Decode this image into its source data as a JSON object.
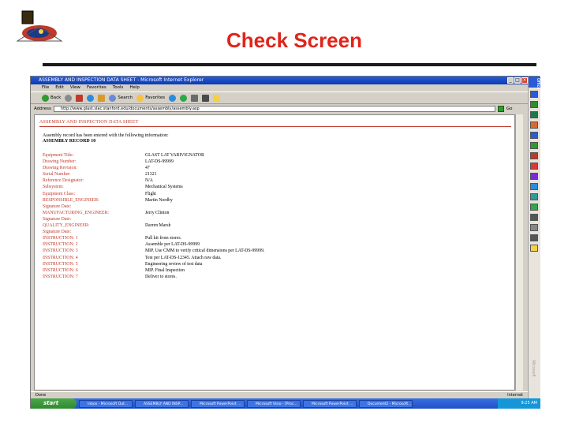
{
  "slide": {
    "title": "Check Screen"
  },
  "window": {
    "title": "ASSEMBLY AND INSPECTION DATA SHEET - Microsoft Internet Explorer",
    "menu": [
      "File",
      "Edit",
      "View",
      "Favorites",
      "Tools",
      "Help"
    ],
    "toolbar": {
      "back": "Back",
      "search": "Search",
      "favorites": "Favorites"
    },
    "address_label": "Address",
    "address_url": "http://www.glast.slac.stanford.edu/documents/assembly/assembly.asp",
    "go_label": "Go"
  },
  "page": {
    "heading": "ASSEMBLY AND INSPECTION DATA SHEET",
    "intro": "Assembly record has been entered with the following information:",
    "record": "ASSEMBLY RECORD 10",
    "rows": [
      {
        "label": "Equipment Title:",
        "value": "GLAST LAT VARIVIGNATOR",
        "dark": false
      },
      {
        "label": "Drawing Number:",
        "value": "LAT-DS-99999",
        "dark": false
      },
      {
        "label": "Drawing Revision:",
        "value": "47",
        "dark": false
      },
      {
        "label": "Serial Number:",
        "value": "21321",
        "dark": false
      },
      {
        "label": "Reference Designator:",
        "value": "N/A",
        "dark": false
      },
      {
        "label": "Subsystem:",
        "value": "Mechanical Systems",
        "dark": false
      },
      {
        "label": "Equipment Class:",
        "value": "Flight",
        "dark": false
      },
      {
        "label": "RESPONSIBLE_ENGINEER:",
        "value": "Martin Nordby",
        "dark": false
      },
      {
        "label": "Signature Date:",
        "value": "",
        "dark": false
      },
      {
        "label": "MANUFACTURING_ENGINEER:",
        "value": "Jerry Clinton",
        "dark": false
      },
      {
        "label": "Signature Date:",
        "value": "",
        "dark": false
      },
      {
        "label": "QUALITY_ENGINEER:",
        "value": "Darren Marsh",
        "dark": false
      },
      {
        "label": "Signature Date:",
        "value": "",
        "dark": false
      },
      {
        "label": "INSTRUCTION: 1",
        "value": "Pull kit from stores.",
        "dark": false
      },
      {
        "label": "INSTRUCTION: 2",
        "value": "Assemble per LAT-DS-99999",
        "dark": false
      },
      {
        "label": "INSTRUCTION: 3",
        "value": "MIP. Use CMM to verify critical dimensions per LAT-DS-99999.",
        "dark": false
      },
      {
        "label": "INSTRUCTION: 4",
        "value": "Test per LAT-DS-12345. Attach raw data.",
        "dark": false
      },
      {
        "label": "INSTRUCTION: 5",
        "value": "Engineering review of test data",
        "dark": false
      },
      {
        "label": "INSTRUCTION: 6",
        "value": "MIP. Final Inspection",
        "dark": false
      },
      {
        "label": "INSTRUCTION: 7",
        "value": "Deliver to stores.",
        "dark": false
      }
    ]
  },
  "status": {
    "left": "Done",
    "right": "Internet"
  },
  "taskbar": {
    "start": "start",
    "tasks": [
      "Inbox - Microsoft Out...",
      "ASSEMBLY AND INSP...",
      "Microsoft PowerPoint ...",
      "Microsoft Visio - [Proc...",
      "Microsoft PowerPoint ...",
      "Document2 - Microsoft..."
    ],
    "clock": "9:25 AM"
  },
  "office_bar": {
    "head": "Office",
    "foot": "Microsoft"
  },
  "colors": {
    "title_red": "#e0241a",
    "label_red": "#c0392b",
    "xp_blue": "#1e4fc6"
  }
}
